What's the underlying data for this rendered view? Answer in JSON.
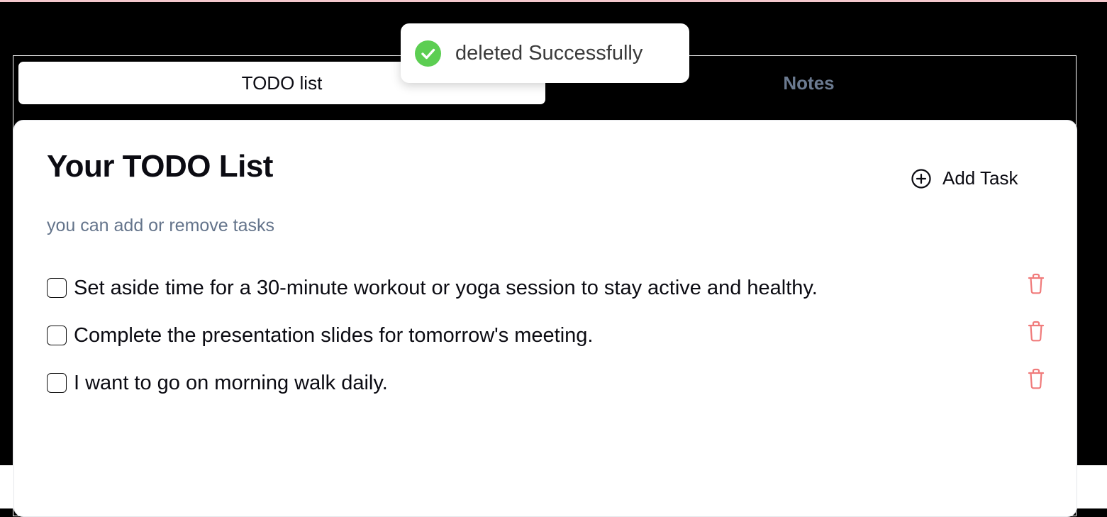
{
  "tabs": [
    {
      "label": "TODO list",
      "active": true
    },
    {
      "label": "Notes",
      "active": false
    }
  ],
  "todo": {
    "title": "Your TODO List",
    "subtitle": "you can add or remove tasks",
    "add_task_label": "Add Task",
    "tasks": [
      {
        "text": "Set aside time for a 30-minute workout or yoga session to stay active and healthy.",
        "checked": false
      },
      {
        "text": "Complete the presentation slides for tomorrow's meeting.",
        "checked": false
      },
      {
        "text": "I want to go on morning walk daily.",
        "checked": false
      }
    ]
  },
  "toast": {
    "message": "deleted Successfully",
    "icon": "check-circle-icon",
    "color": "#5cce52"
  },
  "icons": {
    "add": "plus-circle-icon",
    "delete": "trash-icon"
  },
  "colors": {
    "page_background": "#000000",
    "delete_icon": "#f07b7b",
    "subtitle": "#64748b",
    "inactive_tab": "#6b7a90"
  }
}
